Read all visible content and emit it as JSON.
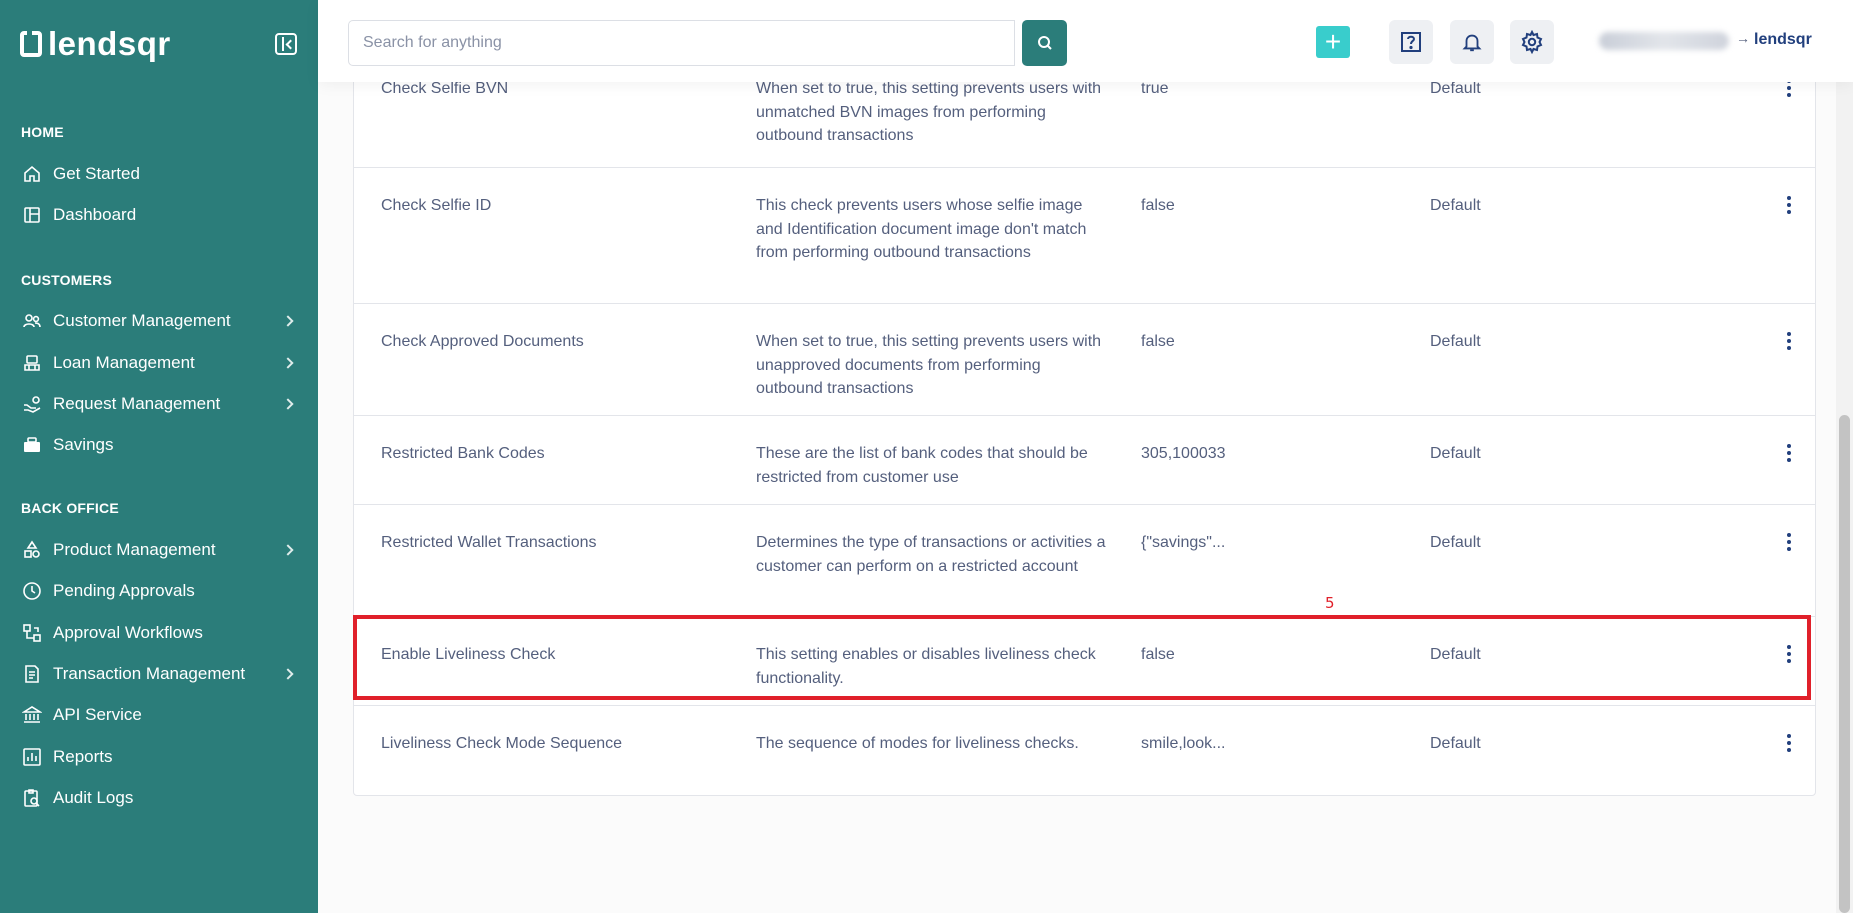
{
  "brand": {
    "name": "lendsqr"
  },
  "sidebar": {
    "sections": [
      {
        "title": "HOME"
      },
      {
        "title": "CUSTOMERS"
      },
      {
        "title": "BACK OFFICE"
      }
    ],
    "items": [
      {
        "label": "Get Started",
        "icon": "home-icon"
      },
      {
        "label": "Dashboard",
        "icon": "dashboard-icon"
      },
      {
        "label": "Customer Management",
        "icon": "users-icon",
        "has_submenu": true
      },
      {
        "label": "Loan Management",
        "icon": "loan-icon",
        "has_submenu": true
      },
      {
        "label": "Request Management",
        "icon": "request-icon",
        "has_submenu": true
      },
      {
        "label": "Savings",
        "icon": "savings-icon"
      },
      {
        "label": "Product Management",
        "icon": "product-icon",
        "has_submenu": true
      },
      {
        "label": "Pending Approvals",
        "icon": "clock-icon"
      },
      {
        "label": "Approval Workflows",
        "icon": "workflow-icon"
      },
      {
        "label": "Transaction Management",
        "icon": "transaction-icon",
        "has_submenu": true
      },
      {
        "label": "API Service",
        "icon": "bank-icon"
      },
      {
        "label": "Reports",
        "icon": "reports-icon"
      },
      {
        "label": "Audit Logs",
        "icon": "audit-icon"
      }
    ]
  },
  "topbar": {
    "search_placeholder": "Search for anything",
    "plus_label": "+",
    "user_arrow": "→",
    "mini_brand": "lendsqr"
  },
  "table": {
    "rows": [
      {
        "name": "Check Selfie BVN",
        "description": "When set to true, this setting prevents users with unmatched BVN images from performing outbound transactions",
        "value": "true",
        "type": "Default"
      },
      {
        "name": "Check Selfie ID",
        "description": "This check prevents users whose selfie image and Identification document image don't match from performing outbound transactions",
        "value": "false",
        "type": "Default"
      },
      {
        "name": "Check Approved Documents",
        "description": "When set to true, this setting prevents users with unapproved documents from performing outbound transactions",
        "value": "false",
        "type": "Default"
      },
      {
        "name": "Restricted Bank Codes",
        "description": "These are the list of bank codes that should be restricted from customer use",
        "value": "305,100033",
        "type": "Default"
      },
      {
        "name": "Restricted Wallet Transactions",
        "description": "Determines the type of transactions or activities a customer can perform on a restricted account",
        "value": "{\"savings\"...",
        "type": "Default"
      },
      {
        "name": "Enable Liveliness Check",
        "description": "This setting enables or disables liveliness check functionality.",
        "value": "false",
        "type": "Default"
      },
      {
        "name": "Liveliness Check Mode Sequence",
        "description": "The sequence of modes for liveliness checks.",
        "value": "smile,look...",
        "type": "Default"
      }
    ]
  },
  "annotation": {
    "label": "5",
    "color": "#e0202a"
  },
  "colors": {
    "sidebar": "#2b7d7a",
    "accent": "#39cdcc",
    "text": "#545f7d",
    "heading": "#213f7d"
  }
}
